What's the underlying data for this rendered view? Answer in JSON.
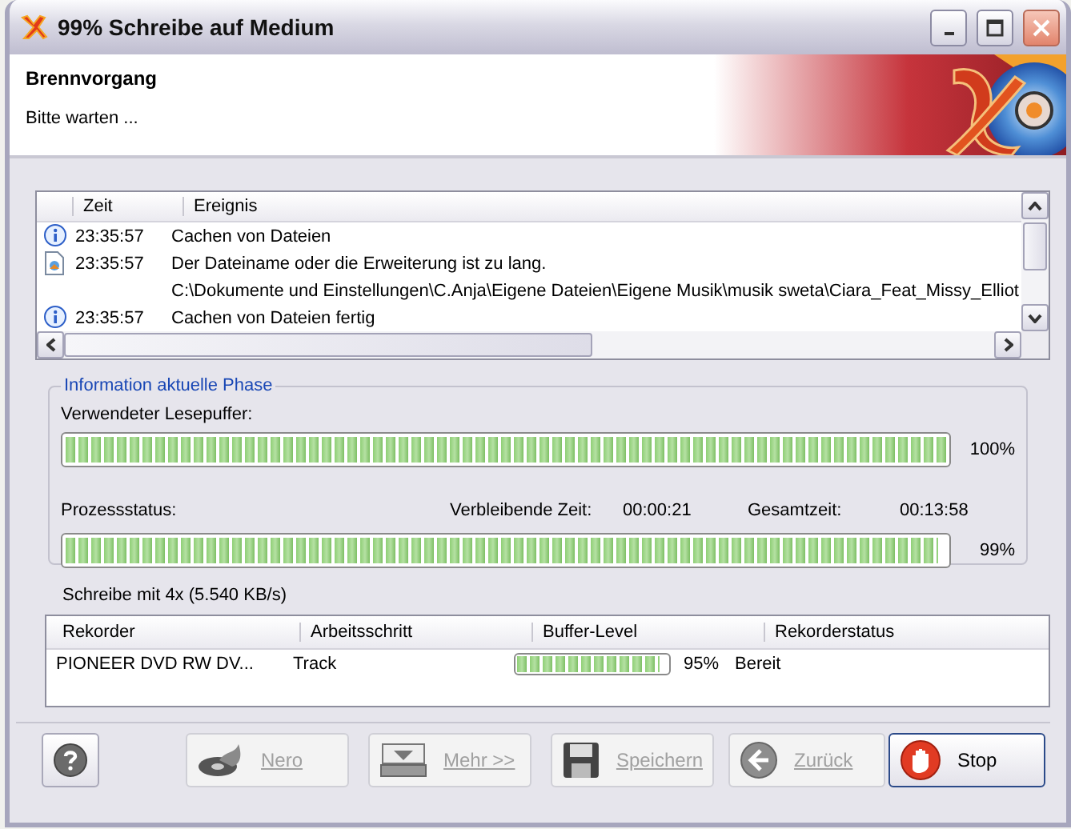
{
  "window": {
    "title": "99% Schreibe auf Medium"
  },
  "header": {
    "title": "Brennvorgang",
    "subtitle": "Bitte warten ..."
  },
  "log": {
    "columns": [
      "Zeit",
      "Ereignis"
    ],
    "rows": [
      {
        "kind": "info",
        "time": "23:35:57",
        "event": "Cachen von Dateien"
      },
      {
        "kind": "file",
        "time": "23:35:57",
        "event": "Der Dateiname oder die Erweiterung ist zu lang."
      },
      {
        "kind": "none",
        "event": "C:\\Dokumente und Einstellungen\\C.Anja\\Eigene Dateien\\Eigene Musik\\musik sweta\\Ciara_Feat_Missy_Elliot"
      },
      {
        "kind": "info",
        "time": "23:35:57",
        "event": "Cachen von Dateien fertig"
      }
    ]
  },
  "phase": {
    "title": "Information aktuelle Phase",
    "buffer_label": "Verwendeter Lesepuffer:",
    "buffer": {
      "level": 1,
      "reading": "100%"
    },
    "process_label": "Prozessstatus:",
    "remaining_label": "Verbleibende Zeit:",
    "remaining": "00:00:21",
    "total_label": "Gesamtzeit:",
    "total": "00:13:58",
    "process": {
      "level": 0.99,
      "reading": "99%"
    }
  },
  "speed": "Schreibe mit 4x (5.540 KB/s)",
  "recorders": {
    "columns": [
      "Rekorder",
      "Arbeitsschritt",
      "Buffer-Level",
      "Rekorderstatus"
    ],
    "rows": [
      {
        "recorder": "PIONEER DVD RW  DV...",
        "step": "Track",
        "buffer": {
          "level": 0.95,
          "reading": "95%"
        },
        "status": "Bereit"
      }
    ]
  },
  "buttons": [
    {
      "kind": "help",
      "disabled": false
    },
    {
      "kind": "nero",
      "label": "Nero",
      "disabled": true
    },
    {
      "kind": "more",
      "label": "Mehr >>",
      "disabled": true
    },
    {
      "kind": "save",
      "label": "Speichern",
      "disabled": true
    },
    {
      "kind": "back",
      "label": "Zurück",
      "disabled": true
    },
    {
      "kind": "stop",
      "label": "Stop",
      "disabled": false
    }
  ]
}
